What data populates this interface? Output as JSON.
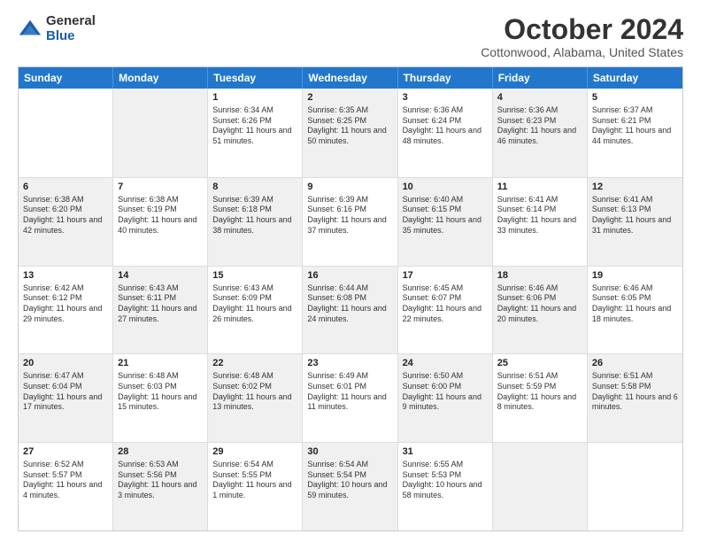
{
  "logo": {
    "general": "General",
    "blue": "Blue"
  },
  "title": "October 2024",
  "subtitle": "Cottonwood, Alabama, United States",
  "header_days": [
    "Sunday",
    "Monday",
    "Tuesday",
    "Wednesday",
    "Thursday",
    "Friday",
    "Saturday"
  ],
  "weeks": [
    [
      {
        "day": "",
        "sunrise": "",
        "sunset": "",
        "daylight": "",
        "shaded": false
      },
      {
        "day": "",
        "sunrise": "",
        "sunset": "",
        "daylight": "",
        "shaded": true
      },
      {
        "day": "1",
        "sunrise": "Sunrise: 6:34 AM",
        "sunset": "Sunset: 6:26 PM",
        "daylight": "Daylight: 11 hours and 51 minutes.",
        "shaded": false
      },
      {
        "day": "2",
        "sunrise": "Sunrise: 6:35 AM",
        "sunset": "Sunset: 6:25 PM",
        "daylight": "Daylight: 11 hours and 50 minutes.",
        "shaded": true
      },
      {
        "day": "3",
        "sunrise": "Sunrise: 6:36 AM",
        "sunset": "Sunset: 6:24 PM",
        "daylight": "Daylight: 11 hours and 48 minutes.",
        "shaded": false
      },
      {
        "day": "4",
        "sunrise": "Sunrise: 6:36 AM",
        "sunset": "Sunset: 6:23 PM",
        "daylight": "Daylight: 11 hours and 46 minutes.",
        "shaded": true
      },
      {
        "day": "5",
        "sunrise": "Sunrise: 6:37 AM",
        "sunset": "Sunset: 6:21 PM",
        "daylight": "Daylight: 11 hours and 44 minutes.",
        "shaded": false
      }
    ],
    [
      {
        "day": "6",
        "sunrise": "Sunrise: 6:38 AM",
        "sunset": "Sunset: 6:20 PM",
        "daylight": "Daylight: 11 hours and 42 minutes.",
        "shaded": true
      },
      {
        "day": "7",
        "sunrise": "Sunrise: 6:38 AM",
        "sunset": "Sunset: 6:19 PM",
        "daylight": "Daylight: 11 hours and 40 minutes.",
        "shaded": false
      },
      {
        "day": "8",
        "sunrise": "Sunrise: 6:39 AM",
        "sunset": "Sunset: 6:18 PM",
        "daylight": "Daylight: 11 hours and 38 minutes.",
        "shaded": true
      },
      {
        "day": "9",
        "sunrise": "Sunrise: 6:39 AM",
        "sunset": "Sunset: 6:16 PM",
        "daylight": "Daylight: 11 hours and 37 minutes.",
        "shaded": false
      },
      {
        "day": "10",
        "sunrise": "Sunrise: 6:40 AM",
        "sunset": "Sunset: 6:15 PM",
        "daylight": "Daylight: 11 hours and 35 minutes.",
        "shaded": true
      },
      {
        "day": "11",
        "sunrise": "Sunrise: 6:41 AM",
        "sunset": "Sunset: 6:14 PM",
        "daylight": "Daylight: 11 hours and 33 minutes.",
        "shaded": false
      },
      {
        "day": "12",
        "sunrise": "Sunrise: 6:41 AM",
        "sunset": "Sunset: 6:13 PM",
        "daylight": "Daylight: 11 hours and 31 minutes.",
        "shaded": true
      }
    ],
    [
      {
        "day": "13",
        "sunrise": "Sunrise: 6:42 AM",
        "sunset": "Sunset: 6:12 PM",
        "daylight": "Daylight: 11 hours and 29 minutes.",
        "shaded": false
      },
      {
        "day": "14",
        "sunrise": "Sunrise: 6:43 AM",
        "sunset": "Sunset: 6:11 PM",
        "daylight": "Daylight: 11 hours and 27 minutes.",
        "shaded": true
      },
      {
        "day": "15",
        "sunrise": "Sunrise: 6:43 AM",
        "sunset": "Sunset: 6:09 PM",
        "daylight": "Daylight: 11 hours and 26 minutes.",
        "shaded": false
      },
      {
        "day": "16",
        "sunrise": "Sunrise: 6:44 AM",
        "sunset": "Sunset: 6:08 PM",
        "daylight": "Daylight: 11 hours and 24 minutes.",
        "shaded": true
      },
      {
        "day": "17",
        "sunrise": "Sunrise: 6:45 AM",
        "sunset": "Sunset: 6:07 PM",
        "daylight": "Daylight: 11 hours and 22 minutes.",
        "shaded": false
      },
      {
        "day": "18",
        "sunrise": "Sunrise: 6:46 AM",
        "sunset": "Sunset: 6:06 PM",
        "daylight": "Daylight: 11 hours and 20 minutes.",
        "shaded": true
      },
      {
        "day": "19",
        "sunrise": "Sunrise: 6:46 AM",
        "sunset": "Sunset: 6:05 PM",
        "daylight": "Daylight: 11 hours and 18 minutes.",
        "shaded": false
      }
    ],
    [
      {
        "day": "20",
        "sunrise": "Sunrise: 6:47 AM",
        "sunset": "Sunset: 6:04 PM",
        "daylight": "Daylight: 11 hours and 17 minutes.",
        "shaded": true
      },
      {
        "day": "21",
        "sunrise": "Sunrise: 6:48 AM",
        "sunset": "Sunset: 6:03 PM",
        "daylight": "Daylight: 11 hours and 15 minutes.",
        "shaded": false
      },
      {
        "day": "22",
        "sunrise": "Sunrise: 6:48 AM",
        "sunset": "Sunset: 6:02 PM",
        "daylight": "Daylight: 11 hours and 13 minutes.",
        "shaded": true
      },
      {
        "day": "23",
        "sunrise": "Sunrise: 6:49 AM",
        "sunset": "Sunset: 6:01 PM",
        "daylight": "Daylight: 11 hours and 11 minutes.",
        "shaded": false
      },
      {
        "day": "24",
        "sunrise": "Sunrise: 6:50 AM",
        "sunset": "Sunset: 6:00 PM",
        "daylight": "Daylight: 11 hours and 9 minutes.",
        "shaded": true
      },
      {
        "day": "25",
        "sunrise": "Sunrise: 6:51 AM",
        "sunset": "Sunset: 5:59 PM",
        "daylight": "Daylight: 11 hours and 8 minutes.",
        "shaded": false
      },
      {
        "day": "26",
        "sunrise": "Sunrise: 6:51 AM",
        "sunset": "Sunset: 5:58 PM",
        "daylight": "Daylight: 11 hours and 6 minutes.",
        "shaded": true
      }
    ],
    [
      {
        "day": "27",
        "sunrise": "Sunrise: 6:52 AM",
        "sunset": "Sunset: 5:57 PM",
        "daylight": "Daylight: 11 hours and 4 minutes.",
        "shaded": false
      },
      {
        "day": "28",
        "sunrise": "Sunrise: 6:53 AM",
        "sunset": "Sunset: 5:56 PM",
        "daylight": "Daylight: 11 hours and 3 minutes.",
        "shaded": true
      },
      {
        "day": "29",
        "sunrise": "Sunrise: 6:54 AM",
        "sunset": "Sunset: 5:55 PM",
        "daylight": "Daylight: 11 hours and 1 minute.",
        "shaded": false
      },
      {
        "day": "30",
        "sunrise": "Sunrise: 6:54 AM",
        "sunset": "Sunset: 5:54 PM",
        "daylight": "Daylight: 10 hours and 59 minutes.",
        "shaded": true
      },
      {
        "day": "31",
        "sunrise": "Sunrise: 6:55 AM",
        "sunset": "Sunset: 5:53 PM",
        "daylight": "Daylight: 10 hours and 58 minutes.",
        "shaded": false
      },
      {
        "day": "",
        "sunrise": "",
        "sunset": "",
        "daylight": "",
        "shaded": true
      },
      {
        "day": "",
        "sunrise": "",
        "sunset": "",
        "daylight": "",
        "shaded": false
      }
    ]
  ]
}
